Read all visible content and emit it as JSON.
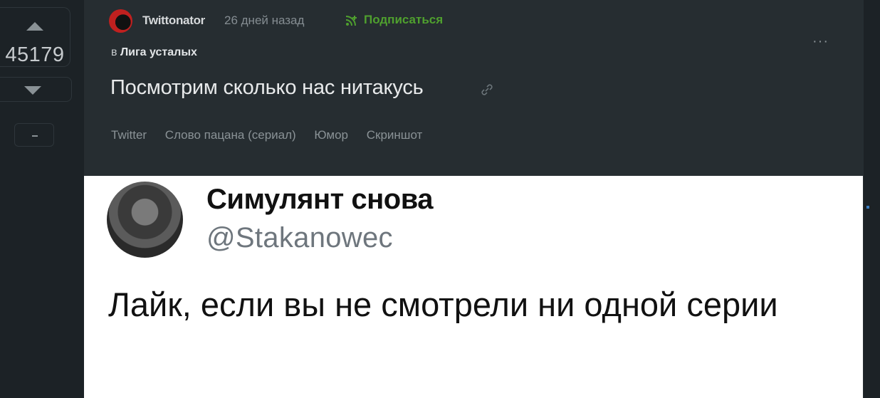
{
  "vote": {
    "rating": "45179"
  },
  "post": {
    "author": "Twittonator",
    "time": "26 дней назад",
    "subscribe_label": "Подписаться",
    "community_prefix": "в",
    "community": "Лига усталых",
    "more_label": "···",
    "title": "Посмотрим сколько нас нитакусь",
    "tags": [
      "Twitter",
      "Слово пацана (сериал)",
      "Юмор",
      "Скриншот"
    ]
  },
  "tweet": {
    "name": "Симулянт снова",
    "handle": "@Stakanowec",
    "text": "Лайк, если вы не смотрели ни одной серии"
  },
  "colors": {
    "background": "#1c2226",
    "post_background": "#262d31",
    "subscribe": "#4fa02e",
    "muted": "#858d92"
  },
  "icons": {
    "vote_up": "triangle-up-icon",
    "vote_down": "triangle-down-icon",
    "subscribe": "rss-plus-icon",
    "link": "link-icon",
    "more": "ellipsis-icon"
  }
}
